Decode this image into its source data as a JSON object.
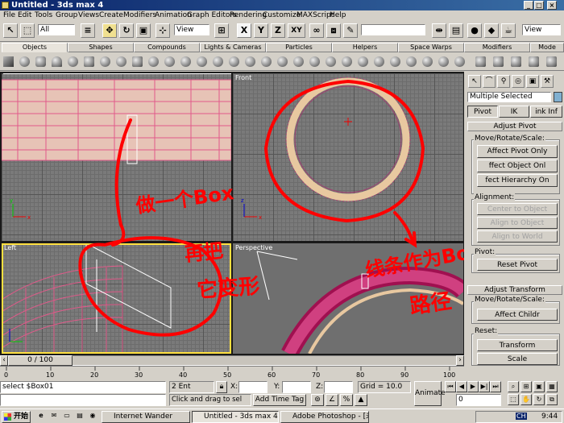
{
  "window": {
    "title": "Untitled - 3ds max 4"
  },
  "menu": [
    "File",
    "Edit",
    "Tools",
    "Group",
    "Views",
    "Create",
    "Modifiers",
    "Animation",
    "Graph Editors",
    "Rendering",
    "Customize",
    "MAXScript",
    "Help"
  ],
  "toolbar": {
    "selection_filter": "All",
    "coord_system": "View",
    "axis_x": "X",
    "axis_y": "Y",
    "axis_z": "Z",
    "axis_xy": "XY",
    "right_dropdown": "View"
  },
  "tabs": [
    "Objects",
    "Shapes",
    "Compounds",
    "Lights & Cameras",
    "Particles",
    "Helpers",
    "Space Warps",
    "Modifiers",
    "Mode"
  ],
  "viewports": {
    "front": "Front",
    "left": "Left",
    "perspective": "Perspective"
  },
  "annotations": {
    "left": "做一个Box\n再把\n它变形",
    "right": "线条作为Box的\n路径"
  },
  "command_panel": {
    "selection_name": "Multiple Selected",
    "tabs": [
      "Pivot",
      "IK",
      "ink Inf"
    ],
    "adjust_pivot": {
      "title": "Adjust Pivot",
      "move_label": "Move/Rotate/Scale:",
      "buttons": [
        "Affect Pivot Only",
        "ffect Object Onl",
        "fect Hierarchy On"
      ]
    },
    "alignment": {
      "label": "Alignment:",
      "buttons": [
        "Center to Object",
        "Align to Object",
        "Align to World"
      ]
    },
    "pivot": {
      "label": "Pivot:",
      "button": "Reset Pivot"
    },
    "adjust_transform": {
      "title": "Adjust Transform",
      "move_label": "Move/Rotate/Scale:",
      "button": "Affect Childr"
    },
    "reset": {
      "label": "Reset:",
      "buttons": [
        "Transform",
        "Scale"
      ]
    }
  },
  "time": {
    "slider_label": "0 / 100",
    "ticks": [
      "0",
      "10",
      "20",
      "30",
      "40",
      "50",
      "60",
      "70",
      "80",
      "90",
      "100"
    ]
  },
  "status": {
    "script_line": "select $Box01",
    "selected_count": "2 Ent",
    "prompt": "Click and drag to sel",
    "x_label": "X:",
    "y_label": "Y:",
    "z_label": "Z:",
    "grid": "Grid = 10.0",
    "add_time_tag": "Add Time Tag",
    "animate": "Animate",
    "frame": "0"
  },
  "taskbar": {
    "start": "开始",
    "tasks": [
      "Internet Wander",
      "Untitled - 3ds max 4",
      "Adobe Photoshop - [未标..."
    ],
    "clock": "9:44",
    "ime": "CH"
  },
  "colors": {
    "annotation": "#ff0000",
    "wire_pink": "#e070a0",
    "ring_beige": "#e8c8a0",
    "title_blue": "#0a246a",
    "grid_bg": "#7a7a7a"
  }
}
